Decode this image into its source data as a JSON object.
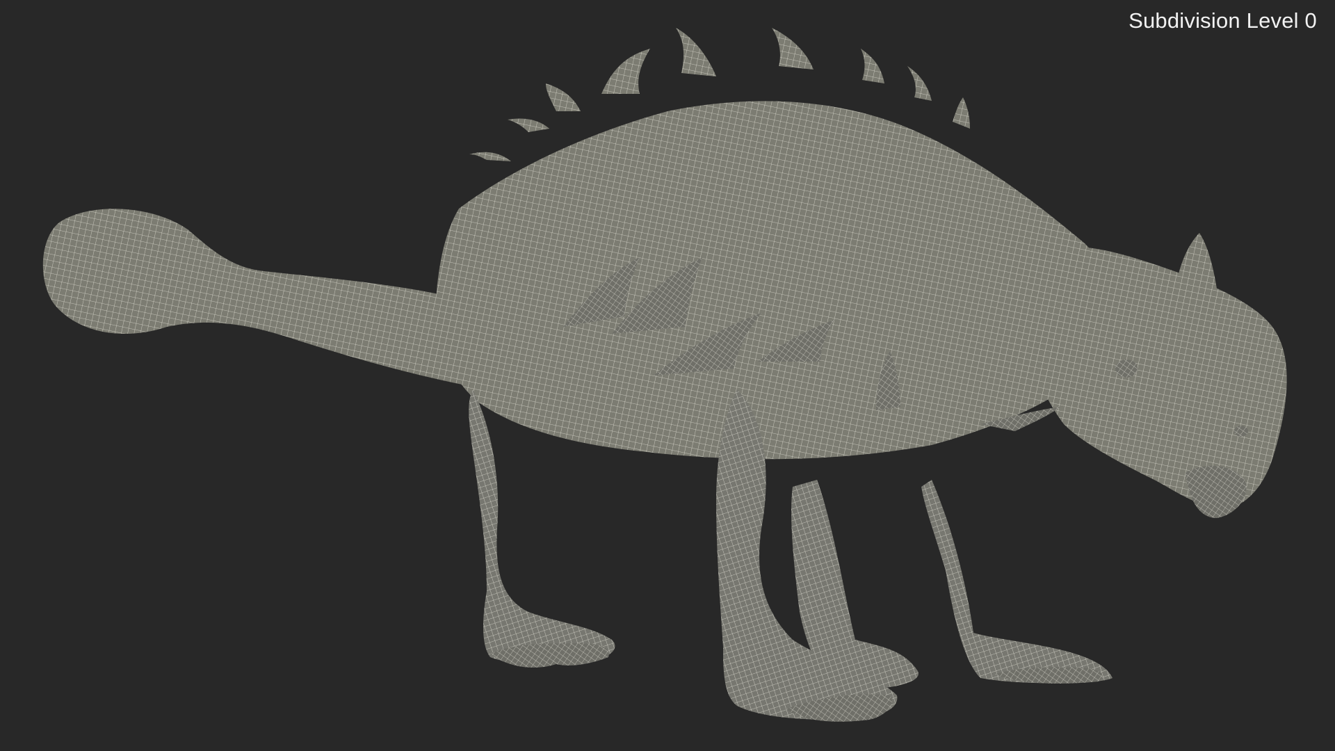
{
  "viewport": {
    "label": "Subdivision Level 0",
    "background_color": "#282828",
    "mesh_fill_color": "#7c7c72",
    "mesh_wire_color": "#ecebdf",
    "model_icon": "ankylosaurus-wireframe-model"
  }
}
